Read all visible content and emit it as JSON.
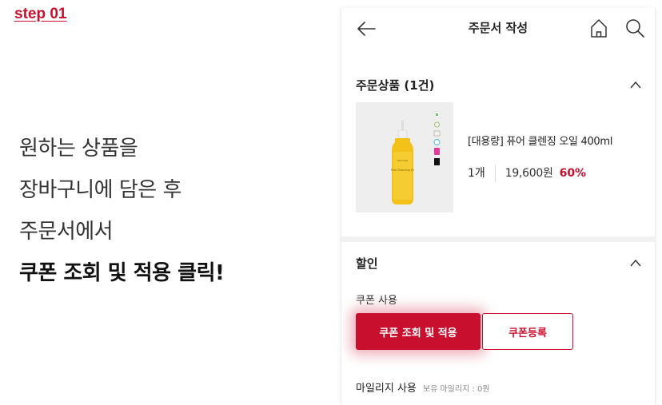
{
  "step_label": "step 01",
  "instructions": [
    "원하는 상품을",
    "장바구니에 담은 후",
    "주문서에서",
    "쿠폰 조회 및 적용 클릭!"
  ],
  "header": {
    "title": "주문서 작성"
  },
  "products": {
    "title": "주문상품 (1건)",
    "item": {
      "name": "[대용량] 퓨어 클렌징 오일 400ml",
      "quantity": "1개",
      "price": "19,600원",
      "discount_rate": "60%",
      "brand_small": "ma:nyo",
      "bottle_text": "Pure Cleansing Oil"
    }
  },
  "discount": {
    "title": "할인",
    "coupon_label": "쿠폰 사용",
    "coupon_button": "쿠폰 조회 및 적용",
    "register_button": "쿠폰등록",
    "mileage_label": "마일리지 사용",
    "mileage_hint": "보유 마일리지 : 0원"
  },
  "colors": {
    "accent": "#c8102e",
    "divider": "#f1f1f1",
    "thumb_bg": "#eeeeee"
  },
  "icons": [
    "back-arrow-icon",
    "home-icon",
    "search-icon",
    "chevron-up-icon"
  ]
}
